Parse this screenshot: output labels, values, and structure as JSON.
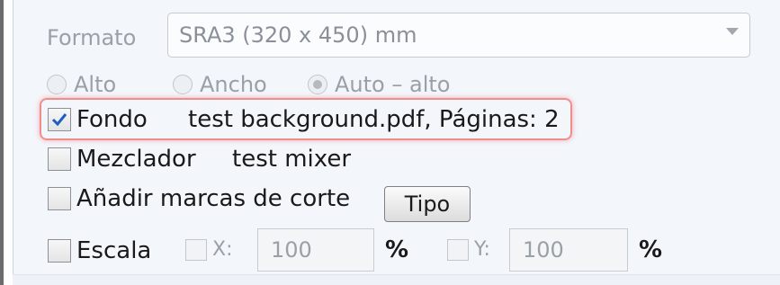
{
  "format": {
    "label": "Formato",
    "selected": "SRA3 (320 x 450) mm"
  },
  "orientation": {
    "options": [
      {
        "label": "Alto",
        "checked": false
      },
      {
        "label": "Ancho",
        "checked": false
      },
      {
        "label": "Auto – alto",
        "checked": true
      }
    ]
  },
  "background": {
    "label": "Fondo",
    "checked": true,
    "info": "test background.pdf, Páginas: 2"
  },
  "mixer": {
    "label": "Mezclador",
    "checked": false,
    "info": "test mixer"
  },
  "crop_marks": {
    "label": "Añadir marcas de corte",
    "checked": false,
    "type_button": "Tipo"
  },
  "scale": {
    "label": "Escala",
    "checked": false,
    "x_label": "X:",
    "x_value": "100",
    "x_unit": "%",
    "y_label": "Y:",
    "y_value": "100",
    "y_unit": "%"
  },
  "colors": {
    "highlight": "#f08e8e",
    "check": "#1f5fbf"
  }
}
